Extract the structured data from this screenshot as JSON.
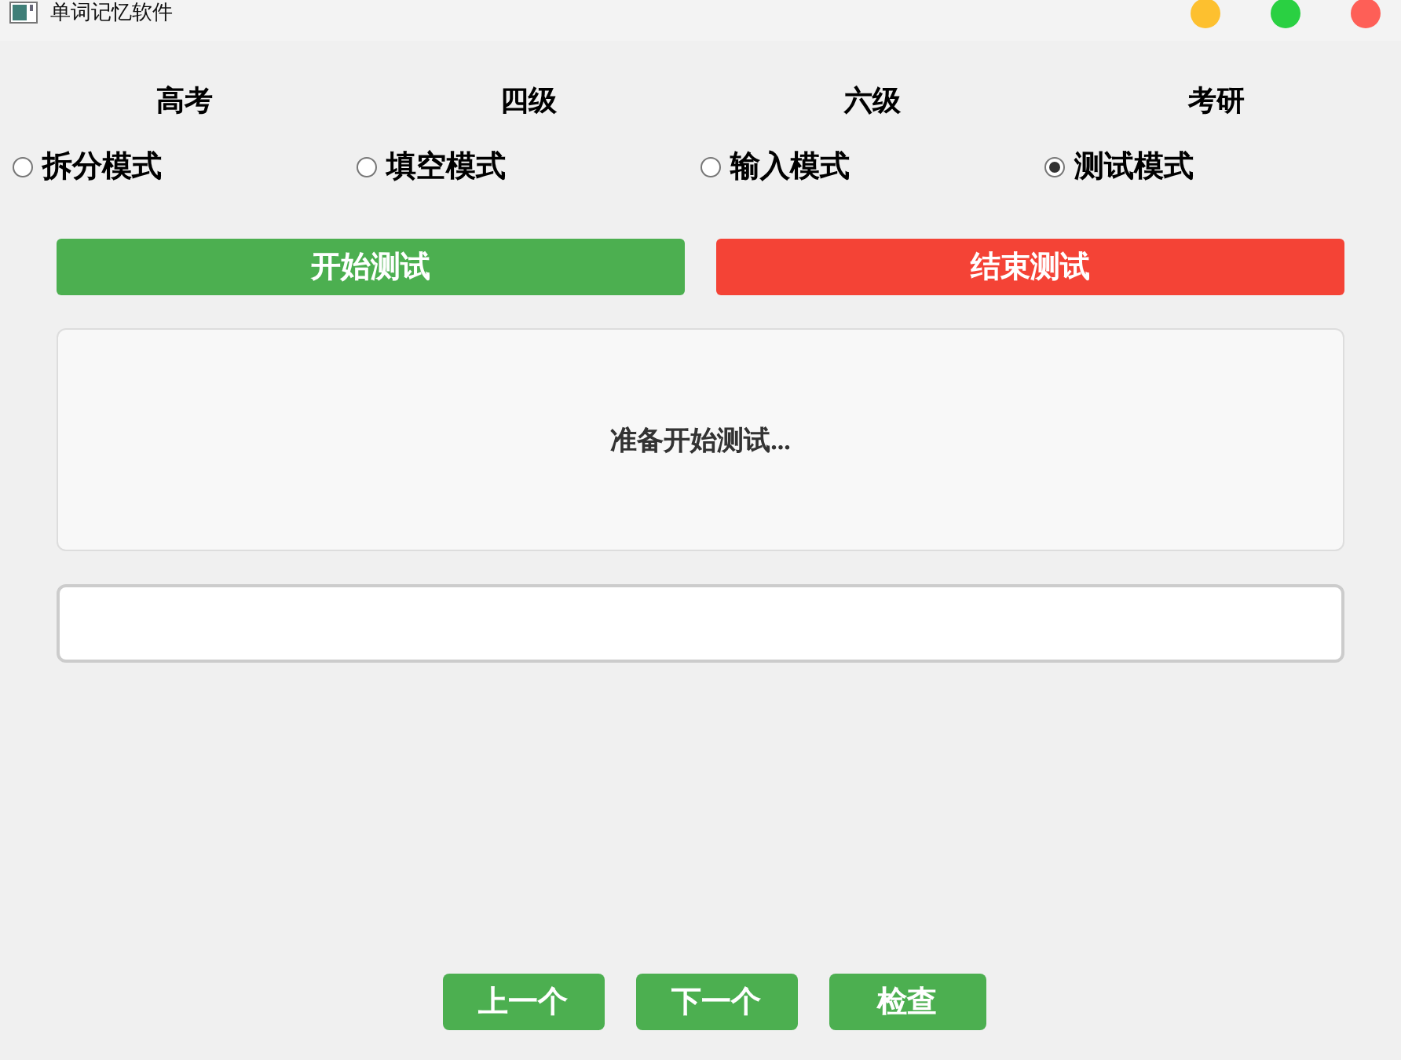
{
  "window": {
    "title": "单词记忆软件"
  },
  "levels": [
    "高考",
    "四级",
    "六级",
    "考研"
  ],
  "modes": [
    {
      "label": "拆分模式",
      "selected": false
    },
    {
      "label": "填空模式",
      "selected": false
    },
    {
      "label": "输入模式",
      "selected": false
    },
    {
      "label": "测试模式",
      "selected": true
    }
  ],
  "test_buttons": [
    {
      "label": "开始测试",
      "kind": "start"
    },
    {
      "label": "结束测试",
      "kind": "stop"
    }
  ],
  "display": {
    "text": "准备开始测试..."
  },
  "nav_buttons": [
    "上一个",
    "下一个",
    "检查"
  ]
}
